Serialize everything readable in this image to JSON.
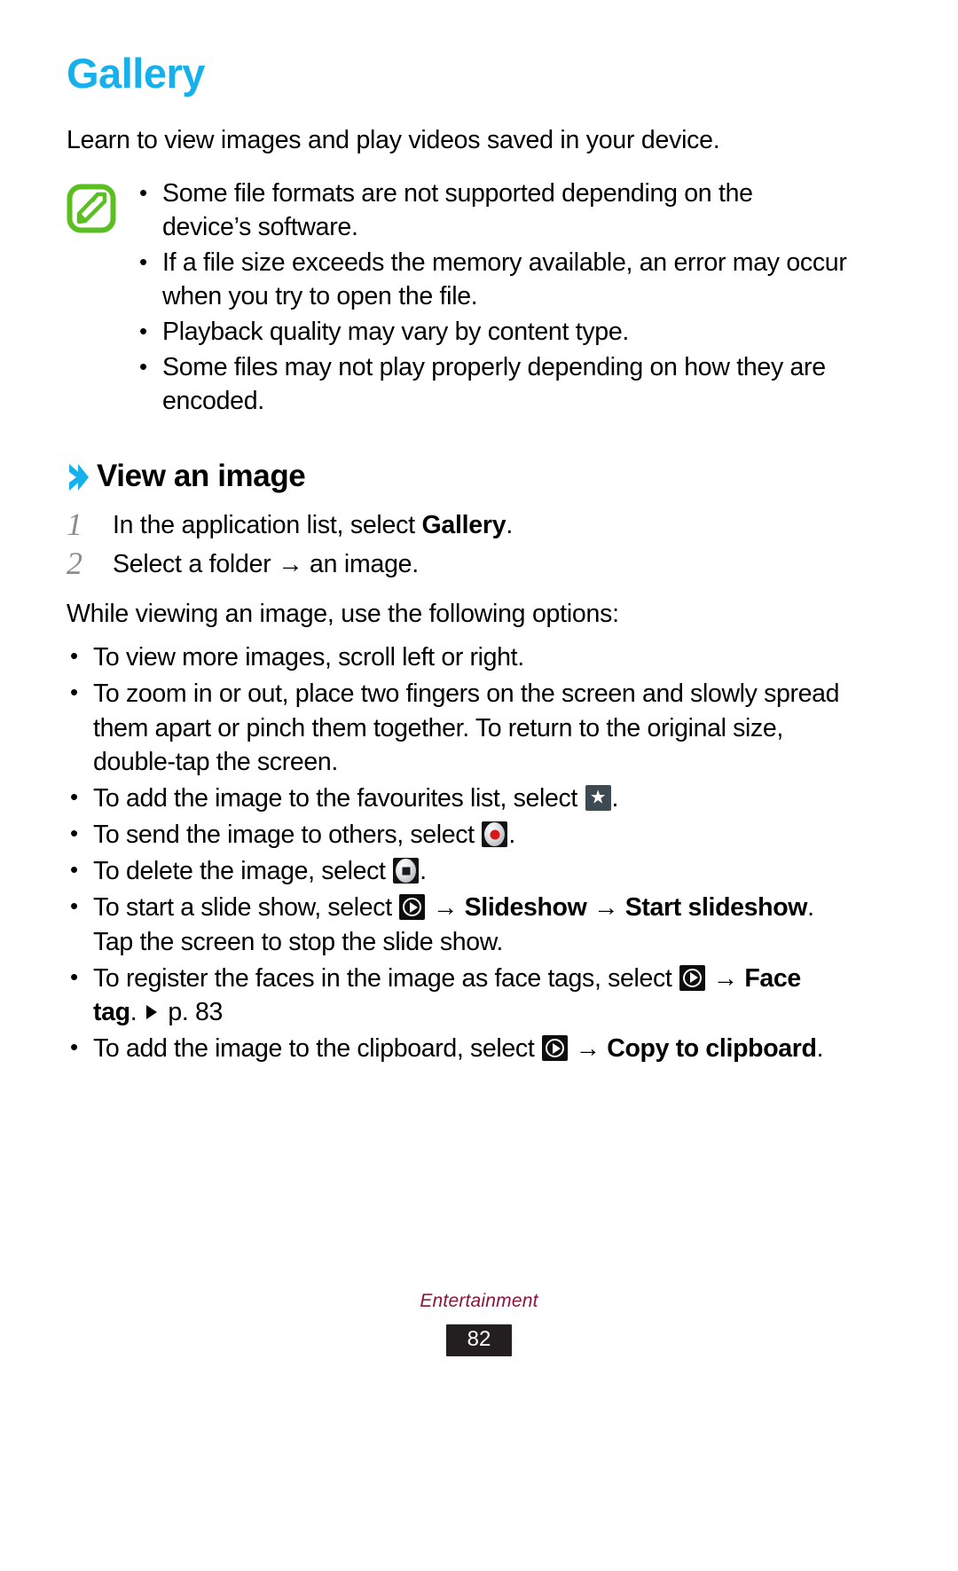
{
  "document": {
    "chapter_title": "Gallery",
    "intro": "Learn to view images and play videos saved in your device."
  },
  "note": {
    "icon": "note-pencil-icon",
    "icon_color": "#5bbf21",
    "items": [
      "Some file formats are not supported depending on the device’s software.",
      "If a file size exceeds the memory available, an error may occur when you try to open the file.",
      "Playback quality may vary by content type.",
      "Some files may not play properly depending on how they are encoded."
    ]
  },
  "section": {
    "chevron_color": "#16b0ed",
    "heading": "View an image",
    "steps": [
      {
        "num": "1",
        "text_before": "In the application list, select ",
        "bold": "Gallery",
        "text_after": "."
      },
      {
        "num": "2",
        "text_before": "Select a folder ",
        "arrow": "→",
        "text_after": " an image."
      }
    ],
    "lead_in": "While viewing an image, use the following options:",
    "options": [
      {
        "id": "scroll",
        "parts": [
          {
            "t": "text",
            "v": "To view more images, scroll left or right."
          }
        ]
      },
      {
        "id": "zoom",
        "parts": [
          {
            "t": "text",
            "v": "To zoom in or out, place two fingers on the screen and slowly spread them apart or pinch them together. To return to the original size, double-tap the screen."
          }
        ]
      },
      {
        "id": "favourite",
        "parts": [
          {
            "t": "text",
            "v": "To add the image to the favourites list, select "
          },
          {
            "t": "icon",
            "v": "star-icon"
          },
          {
            "t": "text",
            "v": "."
          }
        ]
      },
      {
        "id": "send",
        "parts": [
          {
            "t": "text",
            "v": "To send the image to others, select "
          },
          {
            "t": "icon",
            "v": "send-icon"
          },
          {
            "t": "text",
            "v": "."
          }
        ]
      },
      {
        "id": "delete",
        "parts": [
          {
            "t": "text",
            "v": "To delete the image, select "
          },
          {
            "t": "icon",
            "v": "delete-icon"
          },
          {
            "t": "text",
            "v": "."
          }
        ]
      },
      {
        "id": "slideshow",
        "parts": [
          {
            "t": "text",
            "v": "To start a slide show, select "
          },
          {
            "t": "icon",
            "v": "more-options-icon"
          },
          {
            "t": "text",
            "v": " → "
          },
          {
            "t": "bold",
            "v": "Slideshow"
          },
          {
            "t": "text",
            "v": " → "
          },
          {
            "t": "bold",
            "v": "Start slideshow"
          },
          {
            "t": "text",
            "v": ". Tap the screen to stop the slide show."
          }
        ]
      },
      {
        "id": "face-tag",
        "parts": [
          {
            "t": "text",
            "v": "To register the faces in the image as face tags, select "
          },
          {
            "t": "icon",
            "v": "more-options-icon"
          },
          {
            "t": "text",
            "v": " → "
          },
          {
            "t": "bold",
            "v": "Face tag"
          },
          {
            "t": "text",
            "v": ". "
          },
          {
            "t": "ref-icon",
            "v": "triangle-reference-icon"
          },
          {
            "t": "text",
            "v": " p. 83"
          }
        ]
      },
      {
        "id": "clipboard",
        "parts": [
          {
            "t": "text",
            "v": "To add the image to the clipboard, select "
          },
          {
            "t": "icon",
            "v": "more-options-icon"
          },
          {
            "t": "text",
            "v": " → "
          },
          {
            "t": "bold",
            "v": "Copy to clipboard"
          },
          {
            "t": "text",
            "v": "."
          }
        ]
      }
    ]
  },
  "footer": {
    "chapter_label": "Entertainment",
    "page_number": "82",
    "page_badge_color": "#231f20",
    "chapter_label_color": "#8a1538"
  },
  "text": {
    "note_item_1": "Some file formats are not supported depending on the device’s software.",
    "note_item_2": "If a file size exceeds the memory available, an error may occur when you try to open the file.",
    "note_item_3": "Playback quality may vary by content type.",
    "note_item_4": "Some files may not play properly depending on how they are encoded.",
    "step1_prefix": "In the application list, select ",
    "step1_bold": "Gallery",
    "step1_suffix": ".",
    "step2_text": "Select a folder → an image.",
    "opt_scroll": "To view more images, scroll left or right.",
    "opt_zoom": "To zoom in or out, place two fingers on the screen and slowly spread them apart or pinch them together. To return to the original size, double-tap the screen.",
    "opt_fav_prefix": "To add the image to the favourites list, select ",
    "opt_fav_suffix": ".",
    "opt_send_prefix": "To send the image to others, select ",
    "opt_send_suffix": ".",
    "opt_del_prefix": "To delete the image, select ",
    "opt_del_suffix": ".",
    "opt_slide_prefix": "To start a slide show, select ",
    "arrow": " → ",
    "slideshow_bold": "Slideshow",
    "start_slideshow_bold": "Start slideshow",
    "opt_slide_suffix": ". Tap the screen to stop the slide show.",
    "opt_face_prefix": "To register the faces in the image as face tags, select ",
    "face_tag_bold": "Face tag",
    "opt_face_mid": ". ",
    "opt_face_page": " p. 83",
    "opt_clip_prefix": "To add the image to the clipboard, select ",
    "copy_to_clipboard_bold": "Copy to clipboard",
    "opt_clip_suffix": "."
  }
}
